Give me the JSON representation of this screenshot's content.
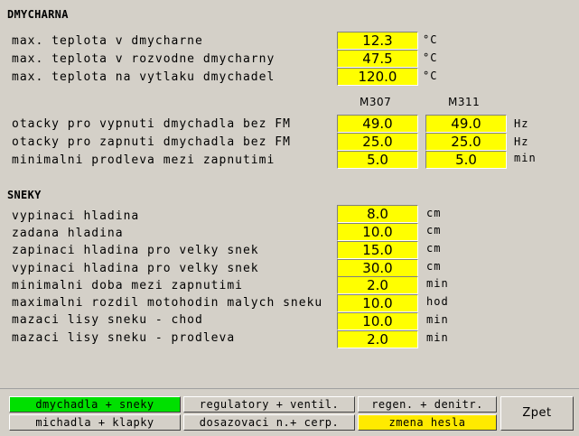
{
  "dmycharna": {
    "title": "DMYCHARNA",
    "rows": [
      {
        "label": "max. teplota v dmycharne",
        "value": "12.3",
        "unit": "°C"
      },
      {
        "label": "max. teplota v rozvodne dmycharny",
        "value": "47.5",
        "unit": "°C"
      },
      {
        "label": "max. teplota na vytlaku dmychadel",
        "value": "120.0",
        "unit": "°C"
      }
    ],
    "col_m307": "M307",
    "col_m311": "M311",
    "dual_rows": [
      {
        "label": "otacky pro vypnuti dmychadla bez FM",
        "m307": "49.0",
        "m311": "49.0",
        "unit": "Hz"
      },
      {
        "label": "otacky pro zapnuti dmychadla bez FM",
        "m307": "25.0",
        "m311": "25.0",
        "unit": "Hz"
      },
      {
        "label": "minimalni prodleva mezi zapnutimi",
        "m307": "5.0",
        "m311": "5.0",
        "unit": "min"
      }
    ]
  },
  "sneky": {
    "title": "SNEKY",
    "rows": [
      {
        "label": "vypinaci hladina",
        "value": "8.0",
        "unit": "cm"
      },
      {
        "label": "zadana hladina",
        "value": "10.0",
        "unit": "cm"
      },
      {
        "label": "zapinaci hladina pro velky snek",
        "value": "15.0",
        "unit": "cm"
      },
      {
        "label": "vypinaci hladina pro velky snek",
        "value": "30.0",
        "unit": "cm"
      },
      {
        "label": "minimalni doba mezi zapnutimi",
        "value": "2.0",
        "unit": "min"
      },
      {
        "label": "maximalni rozdil motohodin malych sneku",
        "value": "10.0",
        "unit": "hod"
      },
      {
        "label": "mazaci lisy sneku - chod",
        "value": "10.0",
        "unit": "min"
      },
      {
        "label": "mazaci lisy sneku - prodleva",
        "value": "2.0",
        "unit": "min"
      }
    ]
  },
  "nav": {
    "row1": [
      "dmychadla + sneky",
      "regulatory + ventil.",
      "regen. + denitr."
    ],
    "row2": [
      "michadla + klapky",
      "dosazovaci n.+ cerp.",
      "zmena hesla"
    ],
    "back": "Zpet"
  },
  "colors": {
    "field": "#ffff00",
    "active_tab": "#00e000",
    "highlight_tab": "#ffea00",
    "background": "#d4d0c8"
  }
}
